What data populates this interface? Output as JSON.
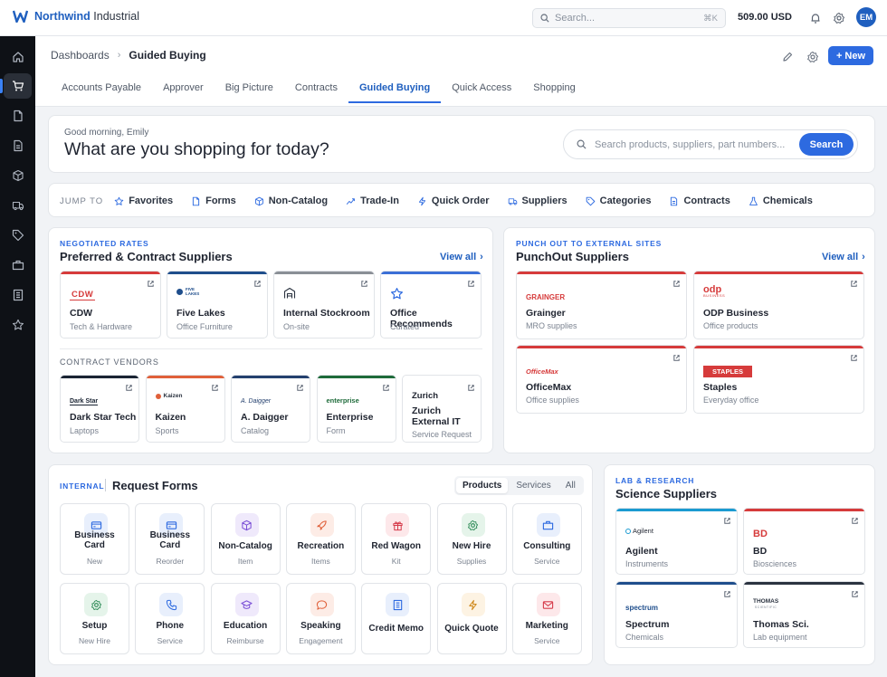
{
  "app": {
    "brand": "Northwind",
    "brand_suffix": "Industrial"
  },
  "topbar": {
    "search_placeholder": "Search...",
    "shortcut": "⌘K",
    "balance": "509.00 USD",
    "avatar_initials": "EM"
  },
  "sidebar": {
    "items": [
      "home-icon",
      "cart-icon",
      "document-icon",
      "file-icon",
      "box-icon",
      "truck-icon",
      "tag-icon",
      "briefcase-icon",
      "ledger-icon",
      "star-icon"
    ],
    "active": "cart-icon"
  },
  "breadcrumb": {
    "parent": "Dashboards",
    "current": "Guided Buying"
  },
  "header": {
    "new_label": "New"
  },
  "tabs": [
    {
      "label": "Accounts Payable"
    },
    {
      "label": "Approver"
    },
    {
      "label": "Big Picture"
    },
    {
      "label": "Contracts"
    },
    {
      "label": "Guided Buying",
      "active": true
    },
    {
      "label": "Quick Access"
    },
    {
      "label": "Shopping"
    }
  ],
  "hero": {
    "greeting": "Good morning, Emily",
    "title": "What are you shopping for today?",
    "search_placeholder": "Search products, suppliers, part numbers...",
    "search_button": "Search"
  },
  "jump": {
    "title": "JUMP TO",
    "items": [
      {
        "label": "Favorites",
        "icon": "star-icon"
      },
      {
        "label": "Forms",
        "icon": "document-icon"
      },
      {
        "label": "Non-Catalog",
        "icon": "box-icon"
      },
      {
        "label": "Trade-In",
        "icon": "trend-icon"
      },
      {
        "label": "Quick Order",
        "icon": "bolt-icon"
      },
      {
        "label": "Suppliers",
        "icon": "truck-icon"
      },
      {
        "label": "Categories",
        "icon": "tag-icon"
      },
      {
        "label": "Contracts",
        "icon": "contract-icon"
      },
      {
        "label": "Chemicals",
        "icon": "flask-icon"
      }
    ]
  },
  "preferred": {
    "eyebrow": "NEGOTIATED RATES",
    "title": "Preferred & Contract Suppliers",
    "view_all": "View all",
    "suppliers": [
      {
        "name": "CDW",
        "sub": "Tech & Hardware",
        "logo": "CDW",
        "bar": "#d63b3b"
      },
      {
        "name": "Five Lakes",
        "sub": "Office Furniture",
        "logo": "FIVE LAKES",
        "bar": "#1f4e8c"
      },
      {
        "name": "Internal Stockroom",
        "sub": "On-site",
        "logo": "",
        "bar": "#8a8f96"
      },
      {
        "name": "Office Recommends",
        "sub": "Curated",
        "logo": "",
        "bar": "#3b6fd6"
      }
    ],
    "vendors_title": "CONTRACT VENDORS",
    "vendors": [
      {
        "name": "Dark Star Tech",
        "sub": "Laptops",
        "logo": "Dark Star",
        "bar": "#1a2433"
      },
      {
        "name": "Kaizen",
        "sub": "Sports",
        "logo": "Kaizen",
        "bar": "#e0603a"
      },
      {
        "name": "A. Daigger",
        "sub": "Catalog",
        "logo": "A. Daigger",
        "bar": "#24406e"
      },
      {
        "name": "Enterprise",
        "sub": "Form",
        "logo": "enterprise",
        "bar": "#1e6b3a"
      },
      {
        "name": "Zurich External IT",
        "sub": "Service Request",
        "logo": "Zurich",
        "bar": "#ffffff"
      }
    ]
  },
  "punchout": {
    "eyebrow": "PUNCH OUT TO EXTERNAL SITES",
    "title": "PunchOut Suppliers",
    "view_all": "View all",
    "suppliers": [
      {
        "name": "Grainger",
        "sub": "MRO supplies",
        "logo": "GRAINGER",
        "bar": "#d63b3b"
      },
      {
        "name": "ODP Business",
        "sub": "Office products",
        "logo": "odp",
        "logo_sub": "BUSINESS",
        "bar": "#d63b3b"
      },
      {
        "name": "OfficeMax",
        "sub": "Office supplies",
        "logo": "OfficeMax",
        "bar": "#d63b3b"
      },
      {
        "name": "Staples",
        "sub": "Everyday office",
        "logo": "STAPLES",
        "bar": "#d63b3b"
      }
    ]
  },
  "forms": {
    "eyebrow": "INTERNAL",
    "title": "Request Forms",
    "segments": [
      "Products",
      "Services",
      "All"
    ],
    "active_segment": "Products",
    "items": [
      {
        "label": "Business Card",
        "sub": "New",
        "icon": "card-icon",
        "color": "#e8effc",
        "fg": "#2d6ae0"
      },
      {
        "label": "Business Card",
        "sub": "Reorder",
        "icon": "card-icon",
        "color": "#e8effc",
        "fg": "#2d6ae0"
      },
      {
        "label": "Non-Catalog",
        "sub": "Item",
        "icon": "box-icon",
        "color": "#efe9fb",
        "fg": "#7a4fd6"
      },
      {
        "label": "Recreation",
        "sub": "Items",
        "icon": "rocket-icon",
        "color": "#fdece6",
        "fg": "#e0603a"
      },
      {
        "label": "Red Wagon",
        "sub": "Kit",
        "icon": "gift-icon",
        "color": "#fde8ea",
        "fg": "#d63b4b"
      },
      {
        "label": "New Hire",
        "sub": "Supplies",
        "icon": "gear-icon",
        "color": "#e5f4ea",
        "fg": "#2e8b57"
      },
      {
        "label": "Consulting",
        "sub": "Service",
        "icon": "briefcase-icon",
        "color": "#e8effc",
        "fg": "#2d6ae0"
      },
      {
        "label": "Setup",
        "sub": "New Hire",
        "icon": "settings-icon",
        "color": "#e5f4ea",
        "fg": "#2e8b57"
      },
      {
        "label": "Phone",
        "sub": "Service",
        "icon": "phone-icon",
        "color": "#e8effc",
        "fg": "#2d6ae0"
      },
      {
        "label": "Education",
        "sub": "Reimburse",
        "icon": "graduation-icon",
        "color": "#efe9fb",
        "fg": "#7a4fd6"
      },
      {
        "label": "Speaking",
        "sub": "Engagement",
        "icon": "chat-icon",
        "color": "#fdece6",
        "fg": "#e0603a"
      },
      {
        "label": "Credit Memo",
        "sub": "",
        "icon": "memo-icon",
        "color": "#e8effc",
        "fg": "#2d6ae0"
      },
      {
        "label": "Quick Quote",
        "sub": "",
        "icon": "bolt-icon",
        "color": "#fdf3e3",
        "fg": "#d08a1e"
      },
      {
        "label": "Marketing",
        "sub": "Service",
        "icon": "mail-icon",
        "color": "#fde8ea",
        "fg": "#d63b4b"
      }
    ]
  },
  "science": {
    "eyebrow": "LAB & RESEARCH",
    "title": "Science Suppliers",
    "suppliers": [
      {
        "name": "Agilent",
        "sub": "Instruments",
        "logo": "Agilent",
        "bar": "#1b9bd1"
      },
      {
        "name": "BD",
        "sub": "Biosciences",
        "logo": "BD",
        "bar": "#d63b3b"
      },
      {
        "name": "Spectrum",
        "sub": "Chemicals",
        "logo": "spectrum",
        "bar": "#1f4e8c"
      },
      {
        "name": "Thomas Sci.",
        "sub": "Lab equipment",
        "logo": "THOMAS",
        "logo_sub": "SCIENTIFIC",
        "bar": "#2b3340"
      }
    ]
  },
  "colors": {
    "accent": "#2d6ae0",
    "sidebar": "#0e1116",
    "page_bg": "#f1f3f6"
  }
}
